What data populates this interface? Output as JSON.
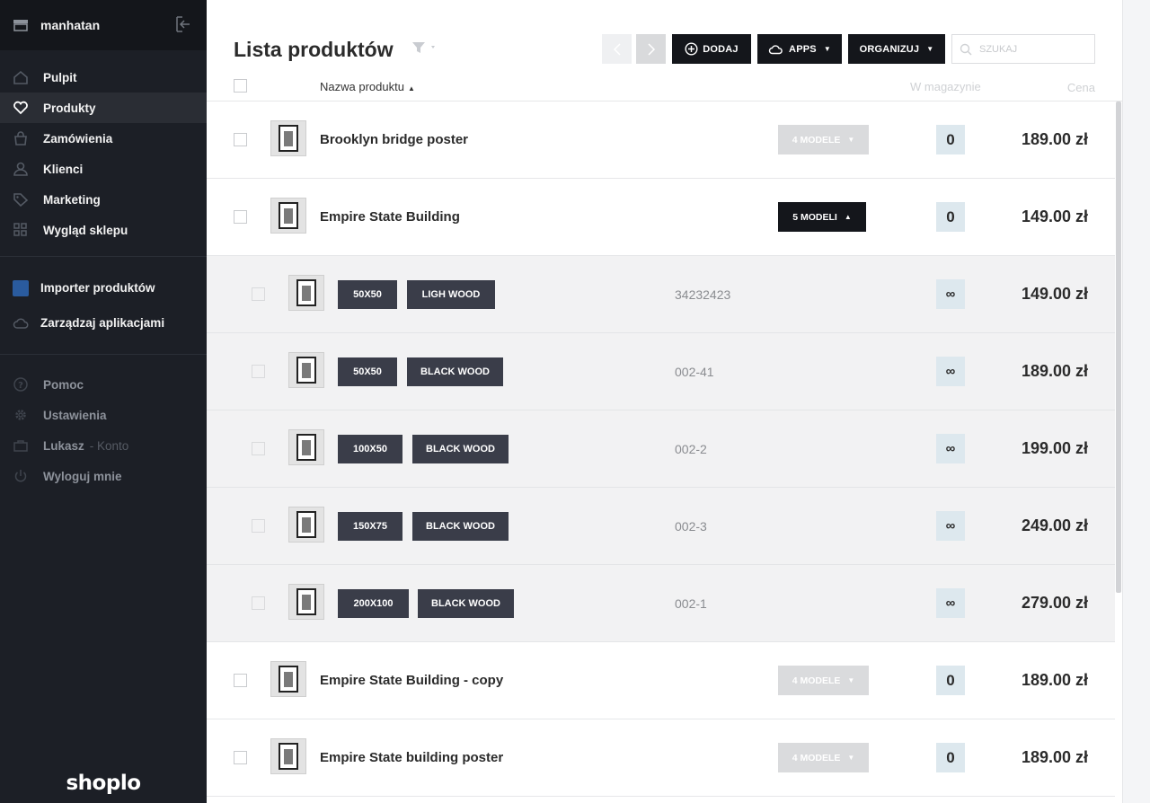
{
  "sidebar": {
    "store_name": "manhatan",
    "nav": [
      {
        "label": "Pulpit",
        "icon": "home-icon"
      },
      {
        "label": "Produkty",
        "icon": "heart-icon"
      },
      {
        "label": "Zamówienia",
        "icon": "orders-icon"
      },
      {
        "label": "Klienci",
        "icon": "user-icon"
      },
      {
        "label": "Marketing",
        "icon": "tag-icon"
      },
      {
        "label": "Wygląd sklepu",
        "icon": "grid-icon"
      }
    ],
    "apps": [
      {
        "label": "Importer produktów",
        "icon": "importer-app-icon"
      },
      {
        "label": "Zarządzaj aplikacjami",
        "icon": "cloud-icon"
      }
    ],
    "system": {
      "help": "Pomoc",
      "settings": "Ustawienia",
      "user": "Lukasz",
      "account": "- Konto",
      "logout": "Wyloguj mnie"
    },
    "brand": "shoplo"
  },
  "header": {
    "title": "Lista produktów",
    "add_label": "DODAJ",
    "apps_label": "APPS",
    "organize_label": "ORGANIZUJ",
    "search_placeholder": "SZUKAJ"
  },
  "table": {
    "col_name": "Nazwa produktu",
    "col_stock": "W magazynie",
    "col_price": "Cena",
    "rows": [
      {
        "name": "Brooklyn bridge poster",
        "models": "4 MODELE",
        "stock": "0",
        "price": "189.00 zł"
      },
      {
        "name": "Empire State Building",
        "models": "5 MODELI",
        "stock": "0",
        "price": "149.00 zł"
      },
      {
        "name": "Empire State Building - copy",
        "models": "4 MODELE",
        "stock": "0",
        "price": "189.00 zł"
      },
      {
        "name": "Empire State building poster",
        "models": "4 MODELE",
        "stock": "0",
        "price": "189.00 zł"
      }
    ],
    "variants": [
      {
        "size": "50X50",
        "finish": "LIGH WOOD",
        "sku": "34232423",
        "stock": "∞",
        "price": "149.00 zł"
      },
      {
        "size": "50X50",
        "finish": "BLACK WOOD",
        "sku": "002-41",
        "stock": "∞",
        "price": "189.00 zł"
      },
      {
        "size": "100X50",
        "finish": "BLACK WOOD",
        "sku": "002-2",
        "stock": "∞",
        "price": "199.00 zł"
      },
      {
        "size": "150X75",
        "finish": "BLACK WOOD",
        "sku": "002-3",
        "stock": "∞",
        "price": "249.00 zł"
      },
      {
        "size": "200X100",
        "finish": "BLACK WOOD",
        "sku": "002-1",
        "stock": "∞",
        "price": "279.00 zł"
      }
    ]
  },
  "colors": {
    "sidebar_bg": "#1c1f26",
    "button_dark": "#14161b",
    "variant_tag": "#3a3d49",
    "stock_badge": "#dde8ee"
  }
}
